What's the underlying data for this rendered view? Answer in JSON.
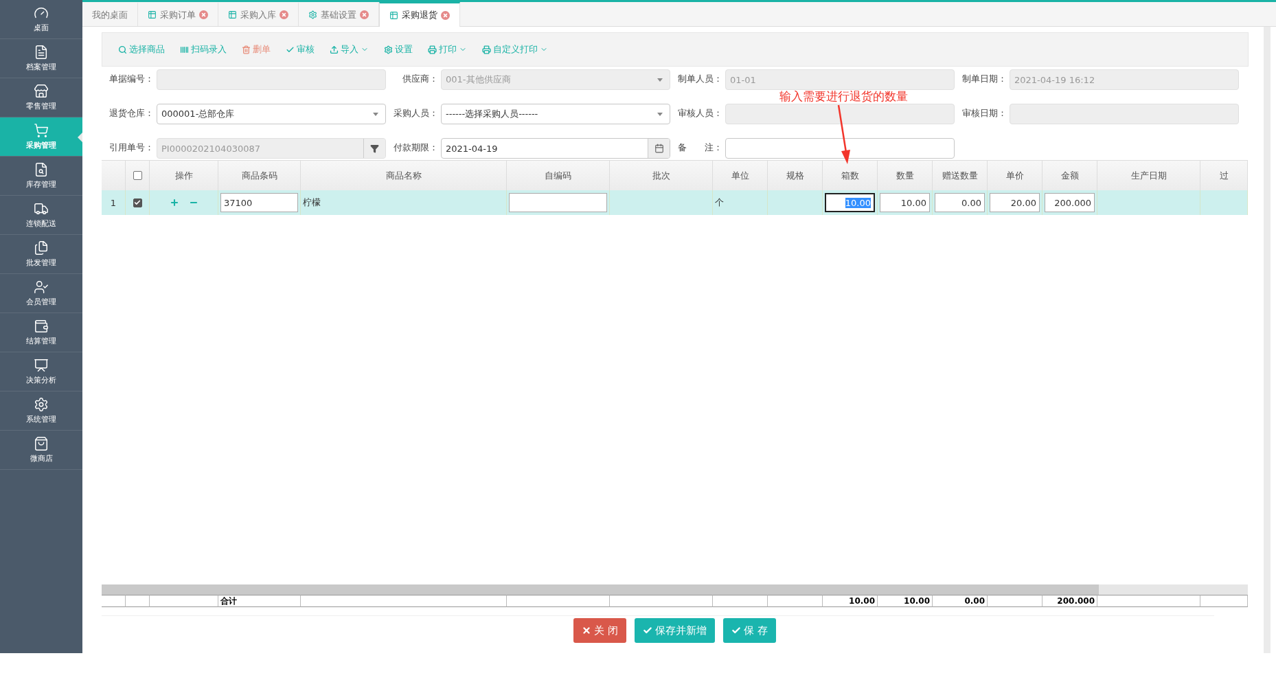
{
  "sidebar": {
    "items": [
      {
        "label": "桌面",
        "selected": false
      },
      {
        "label": "档案管理",
        "selected": false
      },
      {
        "label": "零售管理",
        "selected": false
      },
      {
        "label": "采购管理",
        "selected": true
      },
      {
        "label": "库存管理",
        "selected": false
      },
      {
        "label": "连锁配送",
        "selected": false
      },
      {
        "label": "批发管理",
        "selected": false
      },
      {
        "label": "会员管理",
        "selected": false
      },
      {
        "label": "结算管理",
        "selected": false
      },
      {
        "label": "决策分析",
        "selected": false
      },
      {
        "label": "系统管理",
        "selected": false
      },
      {
        "label": "微商店",
        "selected": false
      }
    ]
  },
  "tabs": [
    {
      "label": "我的桌面",
      "kind": "home",
      "selected": false
    },
    {
      "label": "采购订单",
      "kind": "sheet",
      "selected": false
    },
    {
      "label": "采购入库",
      "kind": "sheet",
      "selected": false
    },
    {
      "label": "基础设置",
      "kind": "settings",
      "selected": false
    },
    {
      "label": "采购退货",
      "kind": "sheet",
      "selected": true
    }
  ],
  "toolbar": [
    {
      "label": "选择商品",
      "kind": "normal",
      "dropdown": false
    },
    {
      "label": "扫码录入",
      "kind": "normal",
      "dropdown": false
    },
    {
      "label": "删单",
      "kind": "danger",
      "dropdown": false
    },
    {
      "label": "审核",
      "kind": "normal",
      "dropdown": false
    },
    {
      "label": "导入",
      "kind": "normal",
      "dropdown": true
    },
    {
      "label": "设置",
      "kind": "normal",
      "dropdown": false
    },
    {
      "label": "打印",
      "kind": "normal",
      "dropdown": true
    },
    {
      "label": "自定义打印",
      "kind": "normal",
      "dropdown": true
    }
  ],
  "form": {
    "fields": [
      {
        "label": "单据编号：",
        "kind": "text",
        "disabled": true
      },
      {
        "label": "供应商：",
        "kind": "select",
        "value": "001-其他供应商",
        "disabled": true
      },
      {
        "label": "制单人员：",
        "kind": "text",
        "value": "01-01",
        "disabled": true
      },
      {
        "label": "制单日期：",
        "kind": "text",
        "value": "2021-04-19 16:12",
        "disabled": true
      },
      {
        "label": "退货仓库：",
        "kind": "select",
        "value": "000001-总部仓库",
        "disabled": false
      },
      {
        "label": "采购人员：",
        "kind": "select",
        "value": "------选择采购人员------",
        "disabled": false
      },
      {
        "label": "审核人员：",
        "kind": "text",
        "disabled": true
      },
      {
        "label": "审核日期：",
        "kind": "text",
        "disabled": true
      },
      {
        "label": "引用单号：",
        "kind": "lookup",
        "value": "PI0000202104030087",
        "disabled": true
      },
      {
        "label": "付款期限：",
        "kind": "date",
        "value": "2021-04-19",
        "disabled": false
      },
      {
        "label": "备　　注：",
        "kind": "text",
        "disabled": false
      }
    ]
  },
  "annotation": {
    "text": "输入需要进行退货的数量"
  },
  "table": {
    "header_checked": false,
    "columns": [
      "",
      "",
      "操作",
      "商品条码",
      "商品名称",
      "自编码",
      "批次",
      "单位",
      "规格",
      "箱数",
      "数量",
      "赠送数量",
      "单价",
      "金额",
      "生产日期",
      "过"
    ],
    "rows": [
      {
        "checked": true,
        "cells": [
          {
            "kind": "number",
            "text": "1"
          },
          {
            "kind": "check"
          },
          {
            "kind": "actions"
          },
          {
            "kind": "input",
            "text": "37100",
            "focused": false
          },
          {
            "kind": "text",
            "text": "柠檬"
          },
          {
            "kind": "input",
            "focused": false
          },
          {
            "kind": "text"
          },
          {
            "kind": "text",
            "text": "个"
          },
          {
            "kind": "text"
          },
          {
            "kind": "input",
            "text": "10.00",
            "focused": true
          },
          {
            "kind": "input",
            "text": "10.00",
            "focused": false
          },
          {
            "kind": "input",
            "text": "0.00",
            "focused": false
          },
          {
            "kind": "input",
            "text": "20.00",
            "focused": false
          },
          {
            "kind": "input",
            "text": "200.000",
            "focused": false
          },
          {
            "kind": "text"
          },
          {
            "kind": "text"
          }
        ]
      }
    ],
    "totals": [
      {
        "kind": "blank"
      },
      {
        "kind": "blank"
      },
      {
        "kind": "blank"
      },
      {
        "kind": "label",
        "text": "合计"
      },
      {
        "kind": "blank"
      },
      {
        "kind": "blank"
      },
      {
        "kind": "blank"
      },
      {
        "kind": "blank"
      },
      {
        "kind": "blank"
      },
      {
        "kind": "value",
        "text": "10.00"
      },
      {
        "kind": "value",
        "text": "10.00"
      },
      {
        "kind": "value",
        "text": "0.00"
      },
      {
        "kind": "blank"
      },
      {
        "kind": "value",
        "text": "200.000"
      },
      {
        "kind": "blank"
      },
      {
        "kind": "blank"
      }
    ]
  },
  "buttons": [
    {
      "label": "关 闭",
      "kind": "danger"
    },
    {
      "label": "保存并新增",
      "kind": "primary"
    },
    {
      "label": "保 存",
      "kind": "primary"
    }
  ]
}
